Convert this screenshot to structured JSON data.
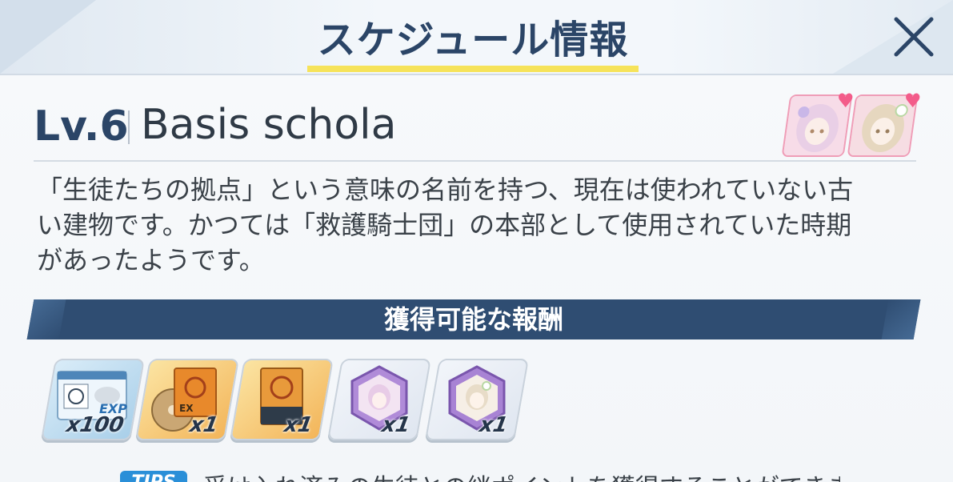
{
  "header": {
    "title": "スケジュール情報"
  },
  "stage": {
    "level": "Lv.6",
    "name": "Basis schola",
    "description_lines": [
      "「生徒たちの拠点」という意味の名前を持つ、現在は使われていない古",
      "い建物です。かつては「救護騎士団」の本部として使用されていた時期",
      "があったようです。"
    ]
  },
  "rewards": {
    "title": "獲得可能な報酬",
    "items": [
      {
        "icon": "location-pass-exp-icon",
        "qty": "x100"
      },
      {
        "icon": "ex-trinity-disc-icon",
        "qty": "x1"
      },
      {
        "icon": "trinity-book-icon",
        "qty": "x1"
      },
      {
        "icon": "student-gift-hexagon-pink-icon",
        "qty": "x1"
      },
      {
        "icon": "student-gift-hexagon-white-icon",
        "qty": "x1"
      }
    ]
  },
  "tips": {
    "badge": "TIPS",
    "text": "受け入れ済みの生徒との絆ポイントを獲得することができます"
  },
  "colors": {
    "accent": "#2b4567",
    "underline": "#f6e35a",
    "bar": "#2f4d72",
    "heart": "#f35c8a"
  }
}
